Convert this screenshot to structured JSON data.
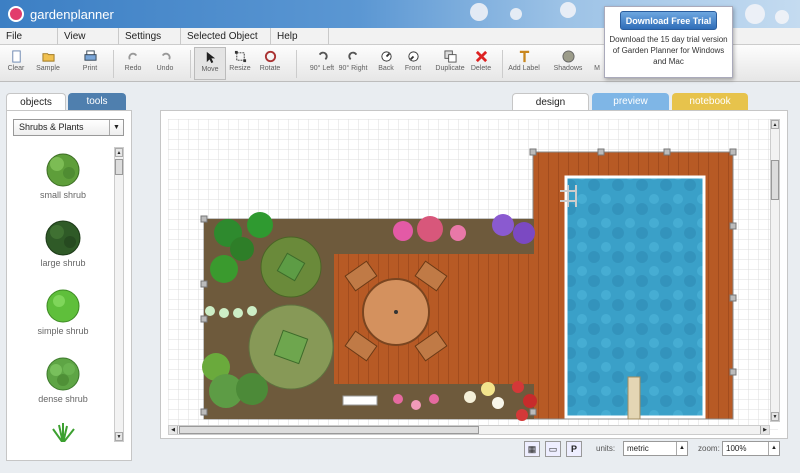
{
  "app": {
    "title": "gardenplanner"
  },
  "menu": [
    "File",
    "View",
    "Settings",
    "Selected Object",
    "Help"
  ],
  "toolbar": {
    "buttons": [
      {
        "label": "Clear",
        "icon": "clear-icon"
      },
      {
        "label": "Sample",
        "icon": "open-folder-icon"
      },
      {
        "label": "Print",
        "icon": "print-icon"
      },
      {
        "label": "Redo",
        "icon": "redo-icon"
      },
      {
        "label": "Undo",
        "icon": "undo-icon"
      },
      {
        "label": "Move",
        "icon": "cursor-icon"
      },
      {
        "label": "Resize",
        "icon": "resize-icon"
      },
      {
        "label": "Rotate",
        "icon": "rotate-icon"
      },
      {
        "label": "90° Left",
        "icon": "rotate-left-icon"
      },
      {
        "label": "90° Right",
        "icon": "rotate-right-icon"
      },
      {
        "label": "Back",
        "icon": "send-back-icon"
      },
      {
        "label": "Front",
        "icon": "bring-front-icon"
      },
      {
        "label": "Duplicate",
        "icon": "duplicate-icon"
      },
      {
        "label": "Delete",
        "icon": "delete-icon"
      },
      {
        "label": "Add Label",
        "icon": "text-icon"
      },
      {
        "label": "Shadows",
        "icon": "shadow-icon"
      },
      {
        "label": "M",
        "icon": ""
      }
    ]
  },
  "promo": {
    "button": "Download Free Trial",
    "text": "Download the 15 day trial version of Garden Planner for Windows and Mac"
  },
  "left_tabs": {
    "objects": "objects",
    "tools": "tools"
  },
  "category": {
    "selected": "Shrubs & Plants"
  },
  "plants": [
    {
      "label": "small shrub",
      "color": "#5e9e3a"
    },
    {
      "label": "large shrub",
      "color": "#2f5a27"
    },
    {
      "label": "simple shrub",
      "color": "#5fbf3b"
    },
    {
      "label": "dense shrub",
      "color": "#5ea545"
    }
  ],
  "view_tabs": {
    "design": "design",
    "preview": "preview",
    "notebook": "notebook"
  },
  "status": {
    "units_label": "units:",
    "units_value": "metric",
    "zoom_label": "zoom:",
    "zoom_value": "100%",
    "p_button": "P"
  },
  "colors": {
    "accent": "#2f6db8",
    "deck": "#b75a25",
    "soil": "#6e5a3c",
    "pool": "#3aa0c8",
    "notebook_tab": "#e7c34c"
  }
}
